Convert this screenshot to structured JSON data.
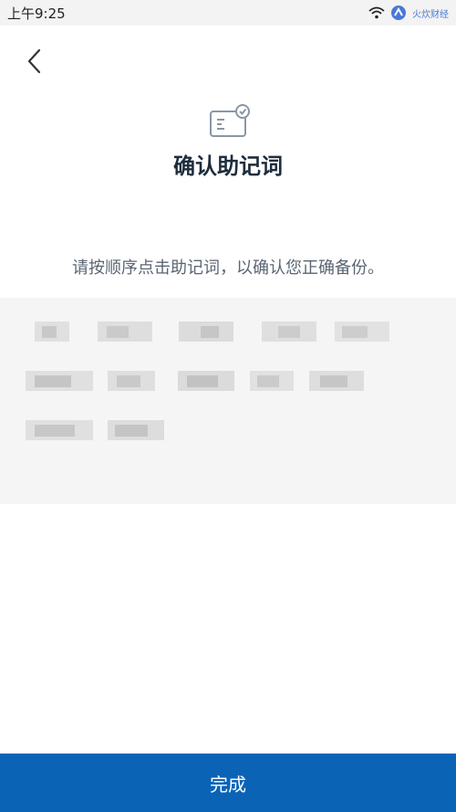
{
  "status_bar": {
    "time": "上午9:25",
    "watermark": "火炊财经"
  },
  "header": {
    "back_icon": "chevron-left-icon",
    "page_icon": "card-check-icon",
    "title": "确认助记词"
  },
  "instruction": "请按顺序点击助记词，以确认您正确备份。",
  "mnemonic": {
    "note": "words are blurred in the screenshot",
    "word_count": 12
  },
  "footer": {
    "done_label": "完成"
  },
  "colors": {
    "primary": "#0b63b6",
    "title": "#1f2d3d",
    "text_secondary": "#5a6573",
    "word_area_bg": "#f5f5f5"
  }
}
